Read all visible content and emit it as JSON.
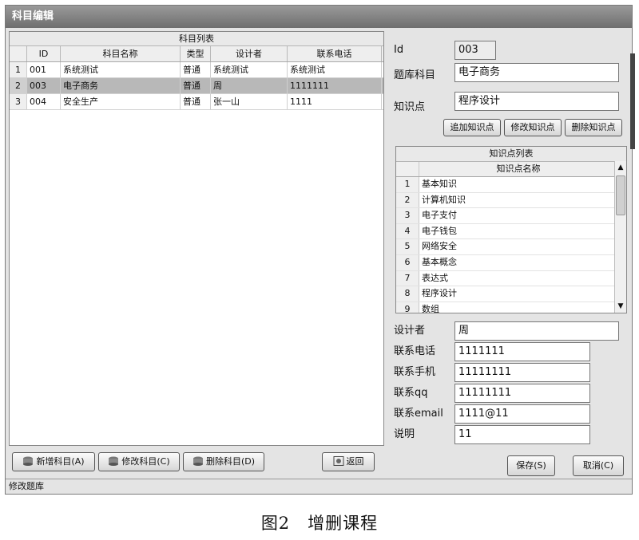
{
  "window": {
    "title": "科目编辑"
  },
  "subject_table": {
    "caption": "科目列表",
    "columns": [
      "ID",
      "科目名称",
      "类型",
      "设计者",
      "联系电话"
    ],
    "rows": [
      {
        "n": "1",
        "id": "001",
        "name": "系统测试",
        "type": "普通",
        "designer": "系统测试",
        "phone": "系统测试"
      },
      {
        "n": "2",
        "id": "003",
        "name": "电子商务",
        "type": "普通",
        "designer": "周",
        "phone": "1111111"
      },
      {
        "n": "3",
        "id": "004",
        "name": "安全生产",
        "type": "普通",
        "designer": "张一山",
        "phone": "1111"
      }
    ],
    "selected_row": 2
  },
  "buttons": {
    "add_subject": "新增科目(A)",
    "edit_subject": "修改科目(C)",
    "delete_subject": "删除科目(D)",
    "back": "返回",
    "add_kp": "追加知识点",
    "edit_kp": "修改知识点",
    "delete_kp": "删除知识点",
    "save": "保存(S)",
    "cancel": "取消(C)"
  },
  "form": {
    "id_label": "Id",
    "id_value": "003",
    "subject_label": "题库科目",
    "subject_value": "电子商务",
    "kp_label": "知识点",
    "kp_value": "程序设计",
    "designer_label": "设计者",
    "designer_value": "周",
    "phone_label": "联系电话",
    "phone_value": "1111111",
    "mobile_label": "联系手机",
    "mobile_value": "11111111",
    "qq_label": "联系qq",
    "qq_value": "11111111",
    "email_label": "联系email",
    "email_value": "1111@11",
    "note_label": "说明",
    "note_value": "11"
  },
  "kp_table": {
    "caption": "知识点列表",
    "column": "知识点名称",
    "rows": [
      {
        "n": "1",
        "name": "基本知识"
      },
      {
        "n": "2",
        "name": "计算机知识"
      },
      {
        "n": "3",
        "name": "电子支付"
      },
      {
        "n": "4",
        "name": "电子钱包"
      },
      {
        "n": "5",
        "name": "网络安全"
      },
      {
        "n": "6",
        "name": "基本概念"
      },
      {
        "n": "7",
        "name": "表达式"
      },
      {
        "n": "8",
        "name": "程序设计"
      },
      {
        "n": "9",
        "name": "数组"
      }
    ]
  },
  "status": {
    "text": "修改题库"
  },
  "figure_caption": "图2　增删课程",
  "icons": {
    "subject_buttons": "database-icon",
    "back": "return-icon"
  }
}
